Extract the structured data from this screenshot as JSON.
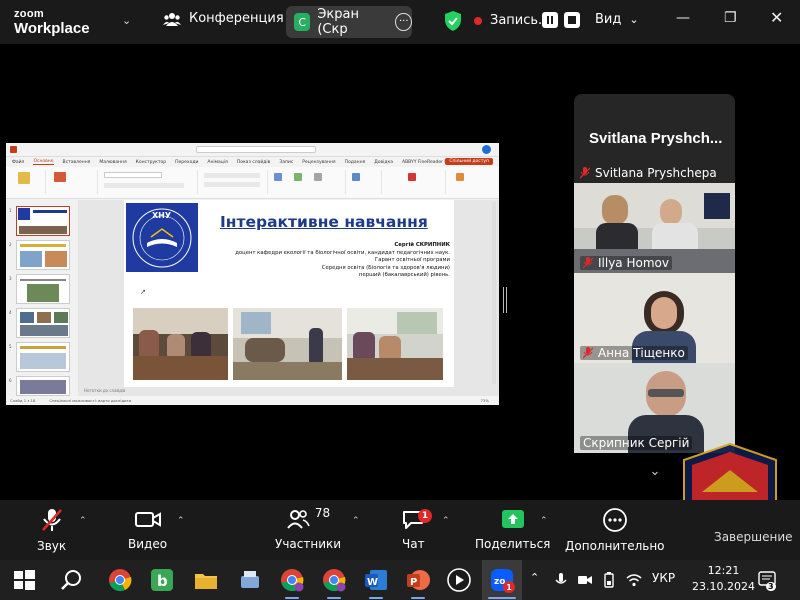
{
  "app": {
    "logo_top": "zoom",
    "logo_bottom": "Workplace",
    "conference_label": "Конференция",
    "share_tab_badge": "C",
    "share_tab_label": "Экран (Скр",
    "recording_label": "Запись...",
    "view_label": "Вид"
  },
  "shared_screen": {
    "ribbon_tabs": [
      "Файл",
      "Основне",
      "Вставлення",
      "Малювання",
      "Конструктор",
      "Переходи",
      "Анімація",
      "Показ слайдів",
      "Запис",
      "Рецензування",
      "Подання",
      "Довідка",
      "ABBYY FineReader PDF",
      "Acrobat"
    ],
    "share_button": "Спільний доступ",
    "slide": {
      "title": "Інтерактивне навчання",
      "author_name": "Сергій СКРИПНИК",
      "author_lines": [
        "доцент кафедри екології та біологічної освіти, кандидат педагогічних наук.",
        "Гарант освітньої програми",
        "Середня освіта (Біологія та здоров'я людини)",
        "перший (бакалаврський) рівень."
      ],
      "logo_text": "ХНУ"
    },
    "notes_placeholder": "Нотатки до слайдів",
    "status_slide": "Слайд 1 з 18",
    "status_accessibility": "Спеціальні можливості: варто дослідити",
    "status_zoom": "73%",
    "thumb_numbers": [
      "1",
      "2",
      "3",
      "4",
      "5",
      "6"
    ]
  },
  "participants": {
    "name_card_big": "Svitlana  Pryshch...",
    "tiles": [
      {
        "name": "Svitlana Pryshchepa",
        "muted": true
      },
      {
        "name": "Illya Homov",
        "muted": true
      },
      {
        "name": "Анна Тіщенко",
        "muted": true
      },
      {
        "name": "Скрипник Сергій",
        "muted": false,
        "active": true
      }
    ]
  },
  "toolbar": {
    "mute_label": "Звук",
    "video_label": "Видео",
    "participants_label": "Участники",
    "participants_count": "78",
    "chat_label": "Чат",
    "chat_badge": "1",
    "share_label": "Поделиться",
    "more_label": "Дополнительно",
    "end_label": "Завершение"
  },
  "taskbar": {
    "zoom_badge": "1",
    "language": "УКР",
    "time": "12:21",
    "date": "23.10.2024",
    "notification_count": "3"
  },
  "colors": {
    "accent_green": "#23d160",
    "record_red": "#e02828",
    "share_green": "#27ae60",
    "slide_title_blue": "#1e3a8a",
    "pp_accent": "#c43e1c"
  }
}
